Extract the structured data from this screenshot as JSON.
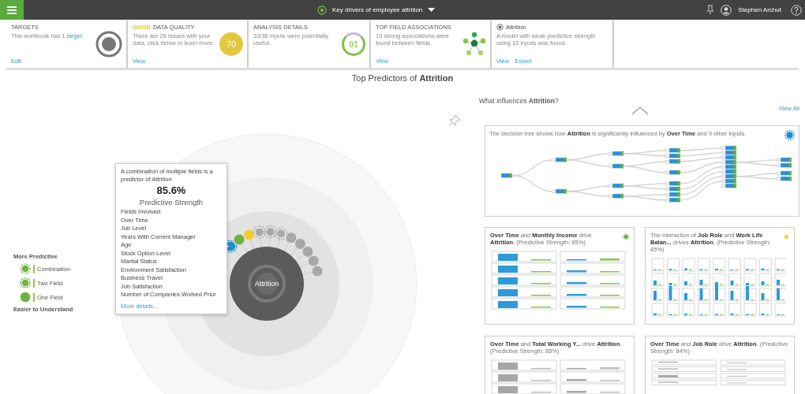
{
  "topbar": {
    "title": "Key drivers of employee attrition",
    "user": "Stephen Archut"
  },
  "summary_cards": [
    {
      "kind": "targets",
      "title": "TARGETS",
      "text": "This workbook has",
      "link_text": "1 target",
      "actions": [
        "Edit"
      ]
    },
    {
      "kind": "quality",
      "highlight": "GOOD",
      "title": "DATA QUALITY",
      "text": "There are 26 issues with your data, click below to learn more.",
      "score": "70",
      "actions": [
        "View"
      ]
    },
    {
      "kind": "analysis",
      "title": "ANALYSIS DETAILS",
      "text": "33/36 inputs were potentially useful.",
      "score": "91"
    },
    {
      "kind": "associations",
      "title": "TOP FIELD ASSOCIATIONS",
      "text": "10 strong associations were found between fields.",
      "actions": [
        "View"
      ]
    },
    {
      "kind": "model",
      "title": "Attrition",
      "text": "A model with weak predictive strength using 10 inputs was found.",
      "actions": [
        "View",
        "Export"
      ]
    }
  ],
  "heading": "Top Predictors of **Attrition**",
  "legend": {
    "top": "More Predictive",
    "items": [
      {
        "kind": "combination",
        "label": "Combination"
      },
      {
        "kind": "two",
        "label": "Two Field"
      },
      {
        "kind": "one",
        "label": "One Field"
      }
    ],
    "bottom": "Easier to Understand"
  },
  "radial": {
    "center_label": "Attrition",
    "nodes": [
      {
        "kind": "combination",
        "color": "#1a8fd6",
        "selected": true
      },
      {
        "kind": "one",
        "color": "#6db33f",
        "selected": false
      },
      {
        "kind": "one",
        "color": "#f2cf2e",
        "selected": false
      },
      {
        "kind": "combination",
        "color": "#a8a8a8",
        "selected": false
      },
      {
        "kind": "combination",
        "color": "#a8a8a8",
        "selected": false
      },
      {
        "kind": "combination",
        "color": "#a8a8a8",
        "selected": false
      },
      {
        "kind": "one",
        "color": "#a8a8a8",
        "selected": false
      },
      {
        "kind": "one",
        "color": "#a8a8a8",
        "selected": false
      },
      {
        "kind": "one",
        "color": "#a8a8a8",
        "selected": false
      },
      {
        "kind": "one",
        "color": "#a8a8a8",
        "selected": false
      },
      {
        "kind": "one",
        "color": "#a8a8a8",
        "selected": false
      }
    ]
  },
  "tooltip": {
    "intro": "A combination of multiple fields is a predictor of Attrition",
    "value": "85.6%",
    "label": "Predictive Strength",
    "fields_heading": "Fields Involved:",
    "fields": [
      "Over Time",
      "Job Level",
      "Years With Current Manager",
      "Age",
      "Stock Option Level",
      "Marital Status",
      "Environment Satisfaction",
      "Business Travel",
      "Job Satisfaction",
      "Number of Companies Worked Prior"
    ],
    "link": "More details..."
  },
  "insights": {
    "heading": "What influences **Attrition**?",
    "view_all": "View All",
    "tree_caption": "The decision tree shows how **Attrition** is significantly influenced by **Over Time** and 9 other inputs.",
    "cards": [
      {
        "kind": "bars",
        "text": "**Over Time** and **Monthly Income** drive **Attrition**. (Predictive Strength: 85%)",
        "color": "#6db33f"
      },
      {
        "kind": "grid",
        "text": "The interaction of **Job Role** and **Work Life Balan...** drives **Attrition**. (Predictive Strength: 85%)",
        "color": "#f2cf2e"
      },
      {
        "kind": "grey-bars",
        "text": "**Over Time** and **Total Working Y...** drive **Attrition**. (Predictive Strength: 85%)"
      },
      {
        "kind": "grey-rows",
        "text": "**Over Time** and **Job Role** drive **Attrition**. (Predictive Strength: 84%)"
      }
    ]
  }
}
